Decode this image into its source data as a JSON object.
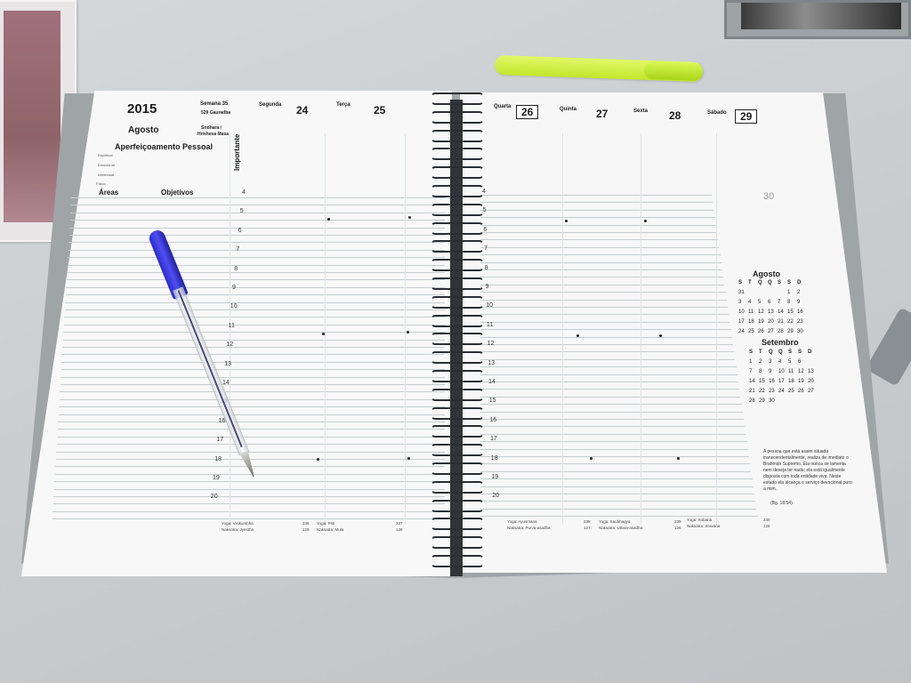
{
  "planner": {
    "year": "2015",
    "week": "Semana 35",
    "week_sub": "529 Gauradba",
    "month": "Agosto",
    "month_sub": "Sridhara /",
    "month_sub2": "Hrishesa Masa",
    "section_title": "Aperfeiçoamento Pessoal",
    "areas_rows": [
      "Espiritual",
      "Emocional",
      "Intelectual",
      "Físico"
    ],
    "col_areas": "Áreas",
    "col_objetivos": "Objetivos",
    "importante": "Importante",
    "days": [
      {
        "name": "Segunda",
        "num": "24"
      },
      {
        "name": "Terça",
        "num": "25"
      },
      {
        "name": "Quarta",
        "num": "26"
      },
      {
        "name": "Quinta",
        "num": "27"
      },
      {
        "name": "Sexta",
        "num": "28"
      },
      {
        "name": "Sábado",
        "num": "29"
      }
    ],
    "hours": [
      "4",
      "5",
      "6",
      "7",
      "8",
      "9",
      "10",
      "11",
      "12",
      "13",
      "14",
      "15",
      "16",
      "17",
      "18",
      "19",
      "20"
    ],
    "bottom_left": [
      {
        "yoga": "Yoga: Visikumbha",
        "num1": "236",
        "nak": "Naksatra: Jyestha",
        "num2": "129"
      },
      {
        "yoga": "Yoga: Priti",
        "num1": "237",
        "nak": "Naksatra: Mula",
        "num2": "128"
      }
    ],
    "bottom_right": [
      {
        "yoga": "Yoga: Ayusmana",
        "num1": "238",
        "nak": "Naksatra: Purva-asadha",
        "num2": "127"
      },
      {
        "yoga": "Yoga: Saubhagya",
        "num1": "239",
        "nak": "Naksatra: Uttara-asadha",
        "num2": "126"
      },
      {
        "yoga": "Yoga: Sobana",
        "num1": "240",
        "nak": "Naksatra: Sravana",
        "num2": "125"
      }
    ],
    "saturday_note_num": "30",
    "mini_cal_1": {
      "title": "Agosto",
      "head": [
        "S",
        "T",
        "Q",
        "Q",
        "S",
        "S",
        "D"
      ],
      "rows": [
        "31 . . . . 1 2",
        "3 4 5 6 7 8 9",
        "10 11 12 13 14 15 16",
        "17 18 19 20 21 22 23",
        "24 25 26 27 28 29 30"
      ]
    },
    "mini_cal_2": {
      "title": "Setembro",
      "head": [
        "S",
        "T",
        "Q",
        "Q",
        "S",
        "S",
        "D"
      ],
      "rows": [
        "1 2 3 4 5 6",
        "7 8 9 10 11 12 13",
        "14 15 16 17 18 19 20",
        "21 22 23 24 25 26 27",
        "28 29 30"
      ]
    },
    "quote": "A pessoa que está assim situada transcendentalmente, realiza de imediato o Brahman Supremo. Ela nunca se lamenta nem deseja ter nada; ela está igualmente disposta com toda entidade viva. Neste estado ela alcança o serviço devocional puro a mim.",
    "quote_ref": "(Bg. 18:54)"
  }
}
